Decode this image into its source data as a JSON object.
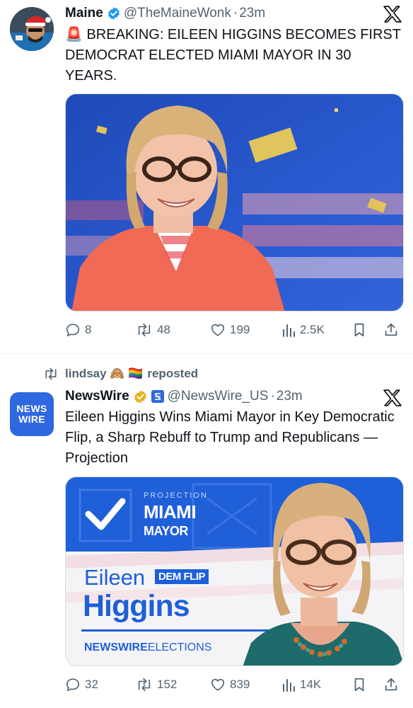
{
  "tweet1": {
    "name": "Maine",
    "handle": "@TheMaineWonk",
    "time": "23m",
    "text": "🚨 BREAKING: EILEEN HIGGINS BECOMES FIRST DEMOCRAT ELECTED MIAMI MAYOR IN 30 YEARS.",
    "replies": "8",
    "reposts": "48",
    "likes": "199",
    "views": "2.5K"
  },
  "tweet2": {
    "repost_user": "lindsay 🙈 🏳️‍🌈",
    "repost_suffix": "reposted",
    "name": "NewsWire",
    "handle": "@NewsWire_US",
    "time": "23m",
    "avatar_line1": "NEWS",
    "avatar_line2": "WIRE",
    "text": "Eileen Higgins Wins Miami Mayor in Key Democratic Flip, a Sharp Rebuff to Trump and Republicans — Projection",
    "card": {
      "projection": "PROJECTION",
      "miami": "MIAMI",
      "mayor": "MAYOR",
      "first_name": "Eileen",
      "badge": "DEM FLIP",
      "last_name": "Higgins",
      "footer_bold": "NEWSWIRE",
      "footer_rest": "ELECTIONS"
    },
    "replies": "32",
    "reposts": "152",
    "likes": "839",
    "views": "14K"
  },
  "colors": {
    "verified_blue": "#1d9bf0",
    "verified_gold": "#e8b321",
    "newswire_blue": "#1f5fd8",
    "text_gray": "#536471"
  },
  "icons": [
    "x-logo-icon",
    "verified-badge-icon",
    "reply-icon",
    "repost-icon",
    "like-icon",
    "views-icon",
    "bookmark-icon",
    "share-icon",
    "siren-icon"
  ]
}
